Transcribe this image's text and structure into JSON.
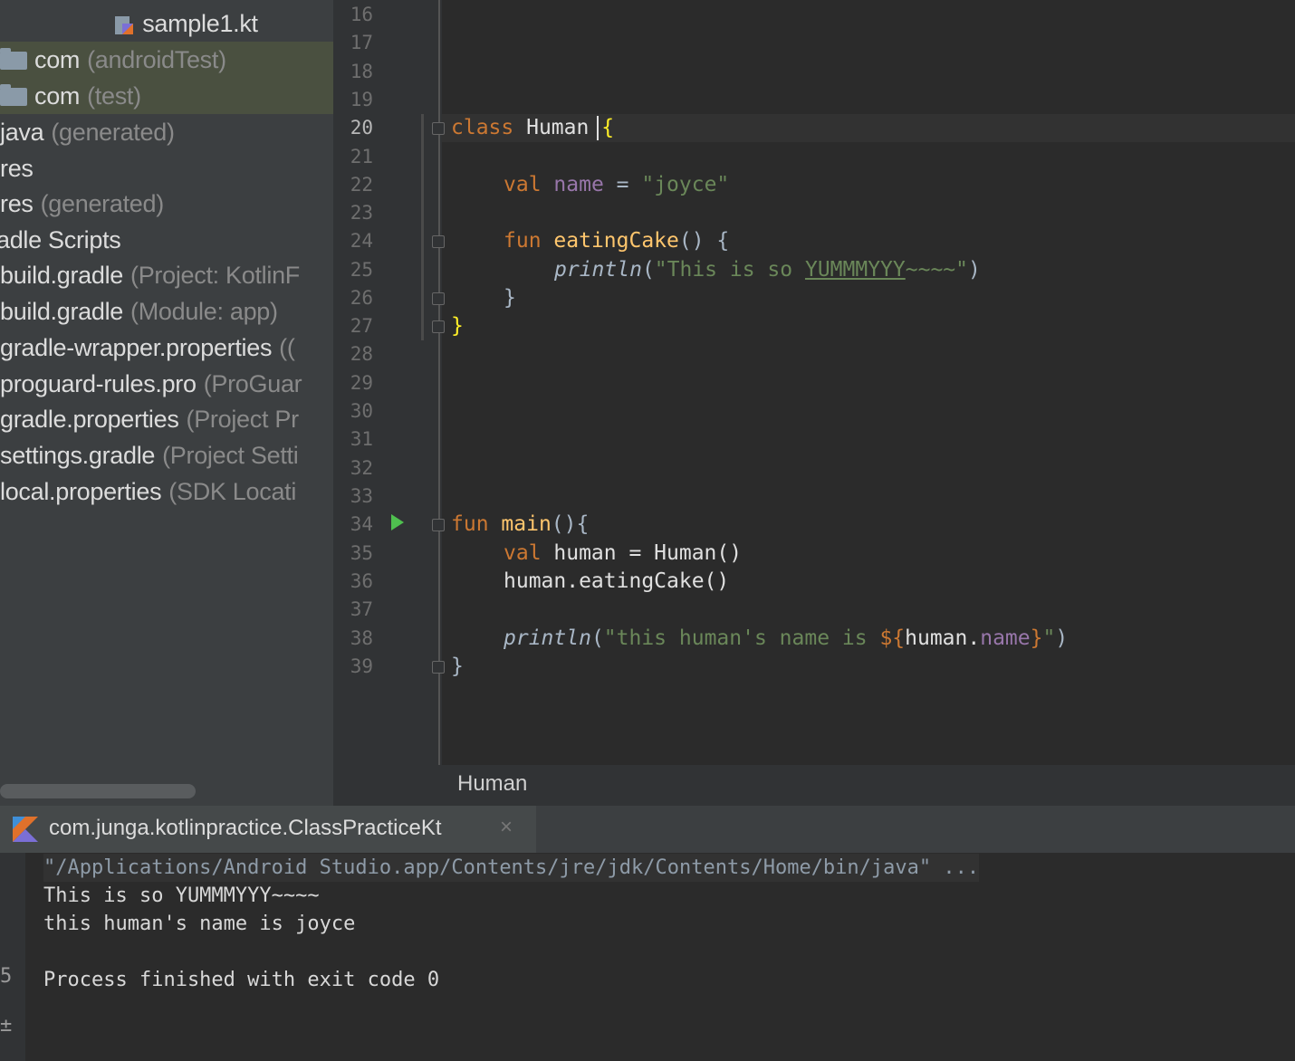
{
  "project_tree": {
    "file_sample": "sample1.kt",
    "items": [
      {
        "name": "com",
        "hint": "(androidTest)"
      },
      {
        "name": "com",
        "hint": "(test)"
      },
      {
        "name": "java",
        "hint": "(generated)"
      },
      {
        "name": "res",
        "hint": ""
      },
      {
        "name": "res",
        "hint": "(generated)"
      },
      {
        "name": "adle Scripts",
        "hint": ""
      },
      {
        "name": "build.gradle",
        "hint": "(Project: KotlinF"
      },
      {
        "name": "build.gradle",
        "hint": "(Module: app)"
      },
      {
        "name": "gradle-wrapper.properties",
        "hint": "(("
      },
      {
        "name": "proguard-rules.pro",
        "hint": "(ProGuar"
      },
      {
        "name": "gradle.properties",
        "hint": "(Project Pr"
      },
      {
        "name": "settings.gradle",
        "hint": "(Project Setti"
      },
      {
        "name": "local.properties",
        "hint": "(SDK Locati"
      }
    ]
  },
  "editor": {
    "line_numbers": [
      "16",
      "17",
      "18",
      "19",
      "20",
      "21",
      "22",
      "23",
      "24",
      "25",
      "26",
      "27",
      "28",
      "29",
      "30",
      "31",
      "32",
      "33",
      "34",
      "35",
      "36",
      "37",
      "38",
      "39"
    ],
    "code": {
      "l20_kw": "class",
      "l20_name": "Human",
      "l20_brace": "{",
      "l22_kw": "val",
      "l22_prop": "name",
      "l22_eq": " = ",
      "l22_str": "\"joyce\"",
      "l24_kw": "fun",
      "l24_fn": "eatingCake",
      "l24_rest": "() {",
      "l25_fn": "println",
      "l25_open": "(",
      "l25_str1": "\"This is so ",
      "l25_str2": "YUMMMYYY",
      "l25_str3": "~~~~\"",
      "l25_close": ")",
      "l26": "}",
      "l27": "}",
      "l34_kw": "fun",
      "l34_fn": "main",
      "l34_rest": "(){",
      "l35_kw": "val",
      "l35_rest": " human = Human()",
      "l36": "human.eatingCake()",
      "l38_fn": "println",
      "l38_open": "(",
      "l38_str": "\"this human's name is ",
      "l38_tmpl_open": "${",
      "l38_obj": "human.",
      "l38_prop": "name",
      "l38_tmpl_close": "}",
      "l38_str_end": "\"",
      "l38_close": ")",
      "l39": "}"
    },
    "breadcrumb": "Human"
  },
  "run_panel": {
    "tab_label": "com.junga.kotlinpractice.ClassPracticeKt",
    "close_glyph": "×",
    "side_glyphs": [
      "5",
      "±"
    ],
    "console": [
      "\"/Applications/Android Studio.app/Contents/jre/jdk/Contents/Home/bin/java\" ...",
      "This is so YUMMMYYY~~~~",
      "this human's name is joyce",
      "",
      "Process finished with exit code 0"
    ]
  },
  "colors": {
    "keyword": "#cc7832",
    "function": "#ffc66d",
    "property": "#9876aa",
    "string": "#6a8759",
    "run_icon": "#4fc04f"
  }
}
